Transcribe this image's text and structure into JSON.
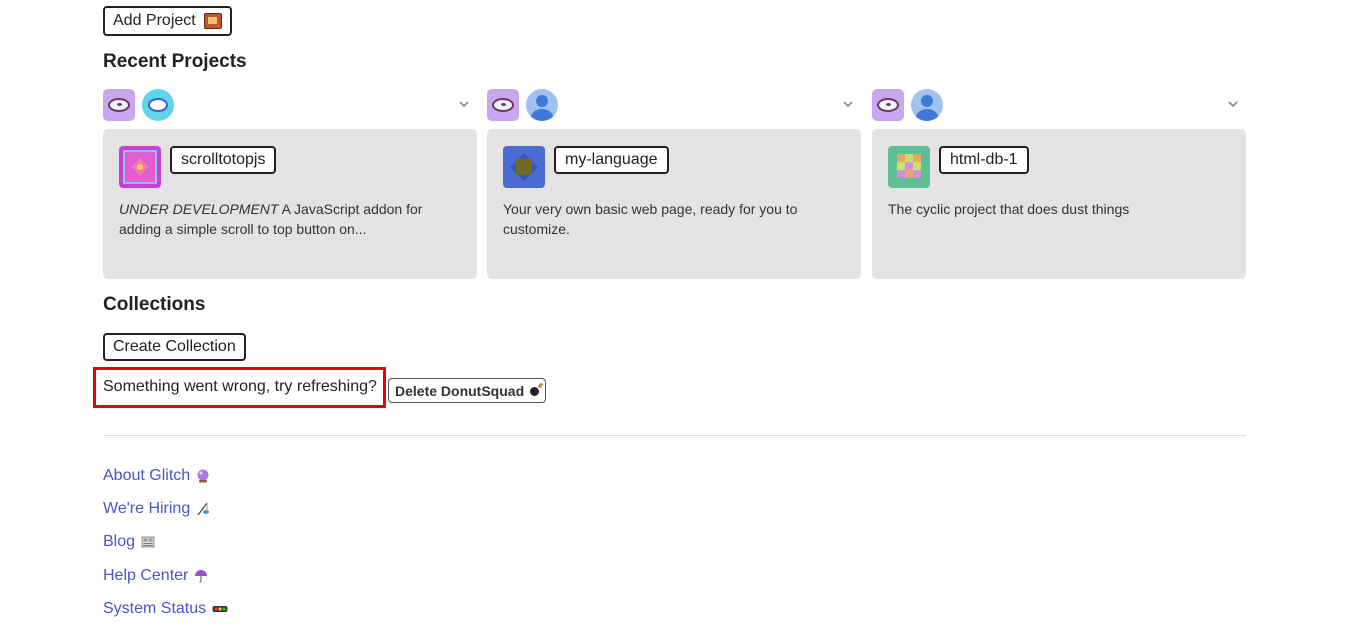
{
  "toolbar": {
    "add_project_label": "Add Project"
  },
  "recent_projects": {
    "heading": "Recent Projects",
    "items": [
      {
        "name": "scrolltotopjs",
        "desc_prefix": "UNDER DEVELOPMENT",
        "desc": " A JavaScript addon for adding a simple scroll to top button on..."
      },
      {
        "name": "my-language",
        "desc_prefix": "",
        "desc": "Your very own basic web page, ready for you to customize."
      },
      {
        "name": "html-db-1",
        "desc_prefix": "",
        "desc": "The cyclic project that does dust things"
      }
    ]
  },
  "collections": {
    "heading": "Collections",
    "create_label": "Create Collection",
    "error_text": "Something went wrong, try refreshing?",
    "delete_label": "Delete DonutSquad"
  },
  "footer": {
    "links": [
      "About Glitch",
      "We're Hiring",
      "Blog",
      "Help Center",
      "System Status"
    ]
  },
  "colors": {
    "link": "#4a55c8",
    "error_outline": "#e8000b",
    "card_bg": "#e3e3e3"
  }
}
